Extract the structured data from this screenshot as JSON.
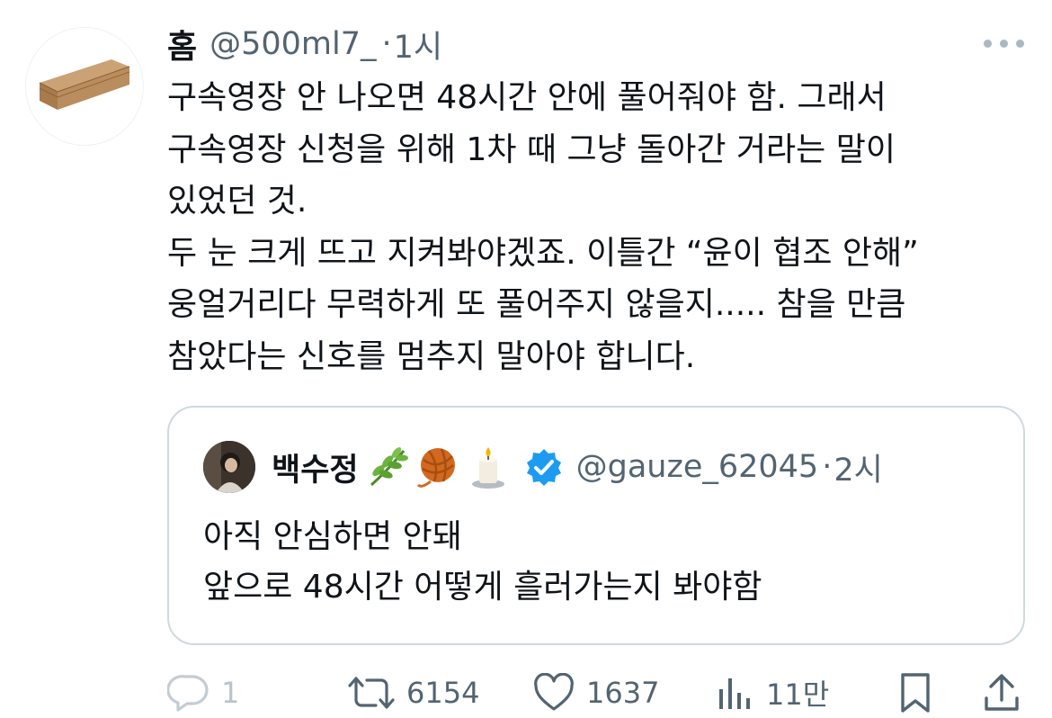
{
  "author": {
    "display_name": "홈",
    "handle": "@500ml7_",
    "separator": "·",
    "time": "1시"
  },
  "tweet_lines": [
    "구속영장 안 나오면 48시간 안에 풀어줘야 함. 그래서",
    "구속영장 신청을 위해 1차 때 그냥 돌아간 거라는 말이",
    "있었던 것.",
    "두 눈 크게 뜨고 지켜봐야겠죠. 이틀간 “윤이 협조 안해”",
    "웅얼거리다 무력하게 또 풀어주지 않을지..... 참을 만큼",
    "참았다는 신호를 멈추지 말아야 합니다."
  ],
  "quoted": {
    "display_name": "백수정",
    "emojis": [
      "herb-emoji",
      "yarn-emoji",
      "candle-emoji"
    ],
    "handle": "@gauze_62045",
    "separator": "·",
    "time": "2시",
    "lines": [
      "아직 안심하면 안돼",
      "앞으로 48시간 어떻게 흘러가는지 봐야함"
    ]
  },
  "actions": {
    "replies": "1",
    "reposts": "6154",
    "likes": "1637",
    "views": "11만"
  },
  "colors": {
    "text": "#0f1419",
    "secondary": "#536471",
    "border": "#cfd9de",
    "verified": "#1d9bf0"
  }
}
